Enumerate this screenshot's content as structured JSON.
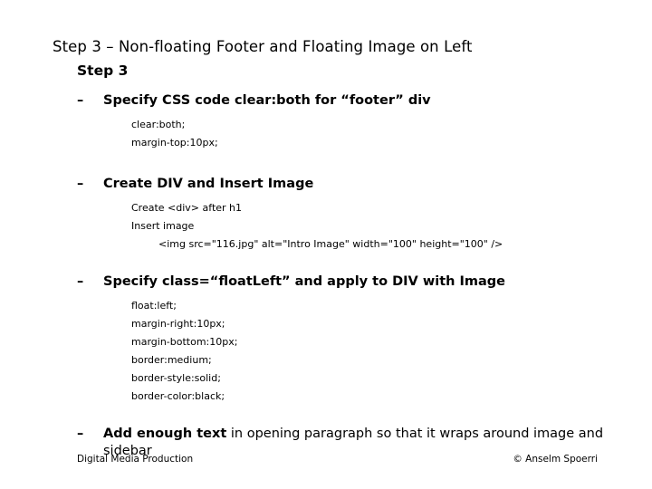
{
  "slide": {
    "title": "Step 3 – Non-floating Footer and Floating Image on Left",
    "section_heading": "Step 3",
    "bullet_marker": "–",
    "bullets": [
      {
        "heading": "Specify CSS code clear:both for “footer” div",
        "details": [
          {
            "text": "clear:both;",
            "indent": 1
          },
          {
            "text": "margin-top:10px;",
            "indent": 1
          }
        ]
      },
      {
        "heading": "Create DIV and Insert Image",
        "details": [
          {
            "text": "Create <div> after h1",
            "indent": 1
          },
          {
            "text": "Insert image",
            "indent": 1
          },
          {
            "text": "<img src=\"116.jpg\" alt=\"Intro Image\" width=\"100\" height=\"100\" />",
            "indent": 2
          }
        ]
      },
      {
        "heading": "Specify class=“floatLeft” and apply to DIV with Image",
        "details": [
          {
            "text": "float:left;",
            "indent": 1
          },
          {
            "text": "margin-right:10px;",
            "indent": 1
          },
          {
            "text": "margin-bottom:10px;",
            "indent": 1
          },
          {
            "text": "border:medium;",
            "indent": 1
          },
          {
            "text": "border-style:solid;",
            "indent": 1
          },
          {
            "text": "border-color:black;",
            "indent": 1
          }
        ]
      },
      {
        "heading_bold": "Add enough text",
        "heading_regular": " in opening paragraph so that it wraps around image and sidebar",
        "details": []
      }
    ]
  },
  "footer": {
    "left": "Digital Media Production",
    "right": "© Anselm Spoerri"
  },
  "colors": {
    "background": "#ffffff",
    "text": "#000000"
  }
}
